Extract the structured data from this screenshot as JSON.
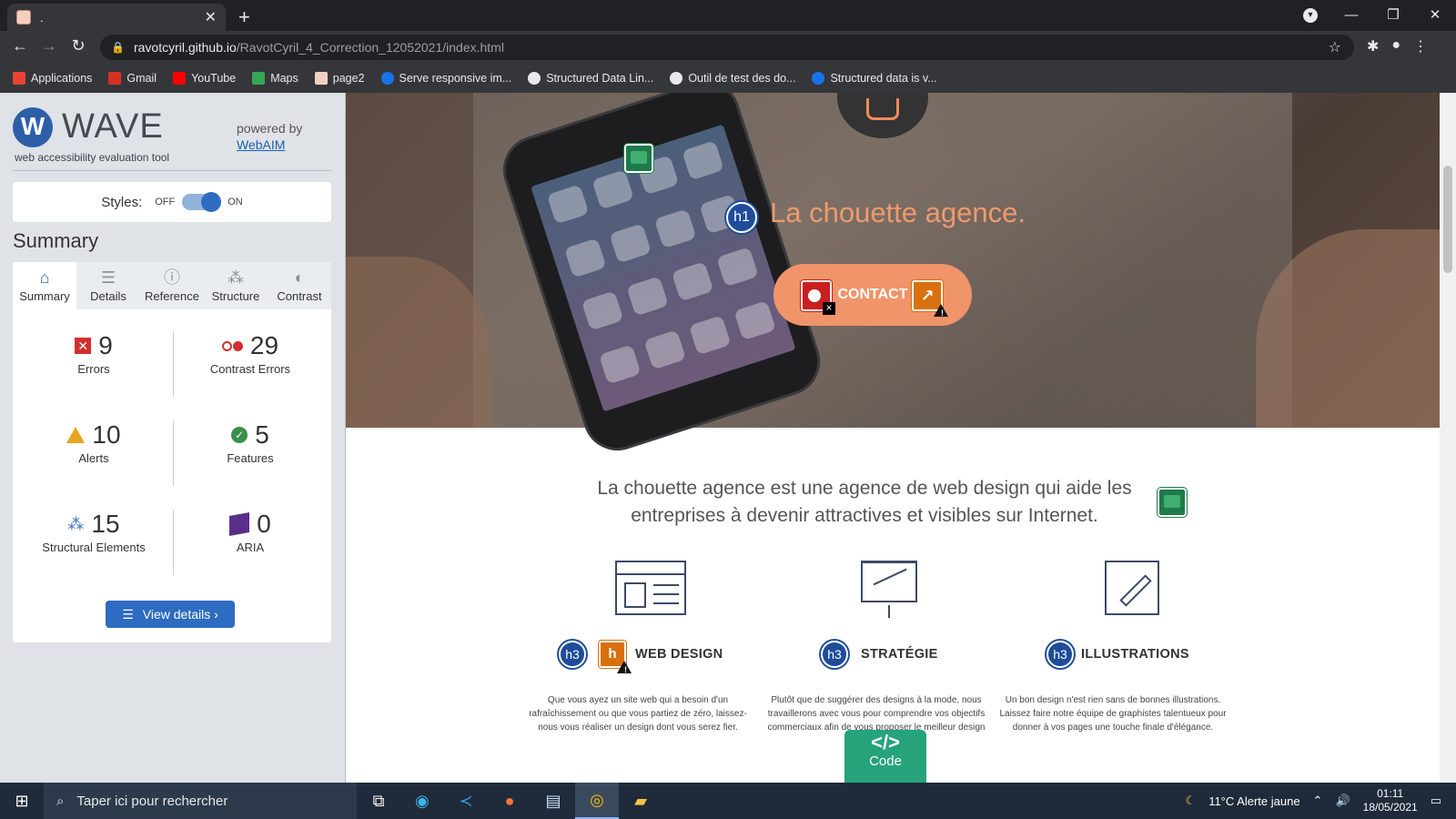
{
  "browser": {
    "tab_title": ".",
    "url_host": "ravotcyril.github.io",
    "url_path": "/RavotCyril_4_Correction_12052021/index.html",
    "bookmarks": [
      {
        "label": "Applications",
        "color": "#ea4335"
      },
      {
        "label": "Gmail",
        "color": "#d93025"
      },
      {
        "label": "YouTube",
        "color": "#ff0000"
      },
      {
        "label": "Maps",
        "color": "#34a853"
      },
      {
        "label": "page2",
        "color": "#f3d1c1"
      },
      {
        "label": "Serve responsive im...",
        "color": "#1a73e8"
      },
      {
        "label": "Structured Data Lin...",
        "color": "#e8eaed"
      },
      {
        "label": "Outil de test des do...",
        "color": "#e8eaed"
      },
      {
        "label": "Structured data is v...",
        "color": "#1a73e8"
      }
    ]
  },
  "wave": {
    "title": "WAVE",
    "subtitle": "web accessibility evaluation tool",
    "powered_by": "powered by",
    "webaim": "WebAIM",
    "styles_label": "Styles:",
    "off": "OFF",
    "on": "ON",
    "summary_heading": "Summary",
    "tabs": [
      {
        "label": "Summary",
        "icon": "home-icon"
      },
      {
        "label": "Details",
        "icon": "list-icon"
      },
      {
        "label": "Reference",
        "icon": "info-icon"
      },
      {
        "label": "Structure",
        "icon": "structure-icon"
      },
      {
        "label": "Contrast",
        "icon": "contrast-icon"
      }
    ],
    "stats": {
      "errors": {
        "value": "9",
        "label": "Errors"
      },
      "contrast": {
        "value": "29",
        "label": "Contrast Errors"
      },
      "alerts": {
        "value": "10",
        "label": "Alerts"
      },
      "features": {
        "value": "5",
        "label": "Features"
      },
      "structural": {
        "value": "15",
        "label": "Structural Elements"
      },
      "aria": {
        "value": "0",
        "label": "ARIA"
      }
    },
    "view_details": "View details ›"
  },
  "site": {
    "hero_title": "La chouette agence.",
    "contact": "CONTACT",
    "intro": "La chouette agence est une agence de web design qui aide les entreprises à devenir attractives et visibles sur Internet.",
    "services": [
      {
        "title": "WEB DESIGN",
        "text": "Que vous ayez un site web qui a besoin d'un rafraîchissement ou que vous partiez de zéro, laissez-nous vous réaliser un design dont vous serez fier."
      },
      {
        "title": "STRATÉGIE",
        "text": "Plutôt que de suggérer des designs à la mode, nous travaillerons avec vous pour comprendre vos objectifs commerciaux afin de vous proposer le meilleur design possible."
      },
      {
        "title": "ILLUSTRATIONS",
        "text": "Un bon design n'est rien sans de bonnes illustrations. Laissez faire notre équipe de graphistes talentueux pour donner à vos pages une touche finale d'élégance."
      }
    ],
    "h1_badge": "h1",
    "h3_badge": "h3",
    "code_label": "Code",
    "code_symbol": "</>"
  },
  "taskbar": {
    "search_placeholder": "Taper ici pour rechercher",
    "weather": "11°C  Alerte jaune",
    "time": "01:11",
    "date": "18/05/2021"
  }
}
